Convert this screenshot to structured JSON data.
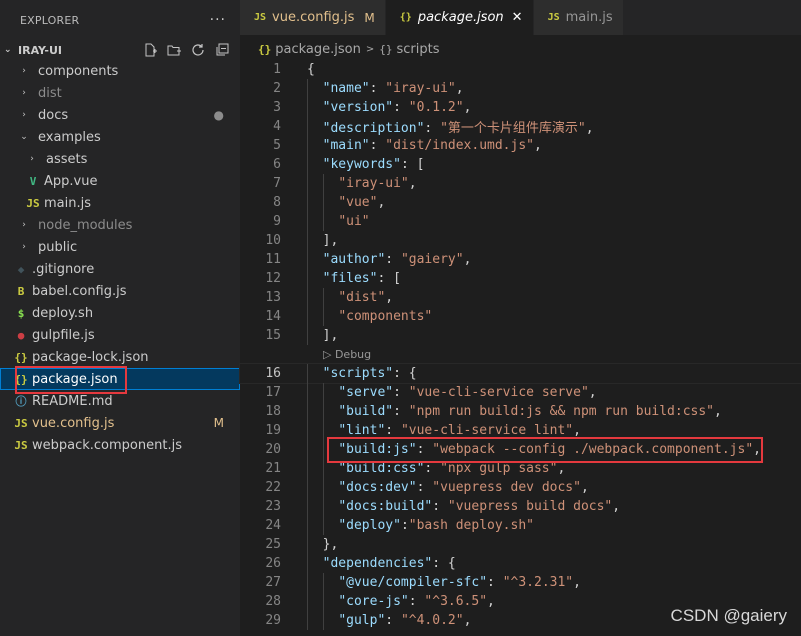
{
  "explorer": {
    "title": "EXPLORER",
    "more": "···",
    "project": "IRAY-UI",
    "items": [
      {
        "label": "components",
        "chev": "›",
        "icon": "",
        "icon_color": "",
        "color": "#cccccc",
        "indent": 18,
        "badge": ""
      },
      {
        "label": "dist",
        "chev": "›",
        "icon": "",
        "icon_color": "",
        "color": "#8c8c8c",
        "indent": 18,
        "badge": ""
      },
      {
        "label": "docs",
        "chev": "›",
        "icon": "",
        "icon_color": "",
        "color": "#cccccc",
        "indent": 18,
        "badge": "●"
      },
      {
        "label": "examples",
        "chev": "⌄",
        "icon": "",
        "icon_color": "",
        "color": "#cccccc",
        "indent": 18,
        "badge": ""
      },
      {
        "label": "assets",
        "chev": "›",
        "icon": "",
        "icon_color": "",
        "color": "#cccccc",
        "indent": 26,
        "badge": ""
      },
      {
        "label": "App.vue",
        "chev": "",
        "icon": "V",
        "icon_color": "#41b883",
        "color": "#cccccc",
        "indent": 26,
        "badge": ""
      },
      {
        "label": "main.js",
        "chev": "",
        "icon": "JS",
        "icon_color": "#cbcb41",
        "color": "#cccccc",
        "indent": 26,
        "badge": ""
      },
      {
        "label": "node_modules",
        "chev": "›",
        "icon": "",
        "icon_color": "",
        "color": "#8c8c8c",
        "indent": 18,
        "badge": ""
      },
      {
        "label": "public",
        "chev": "›",
        "icon": "",
        "icon_color": "",
        "color": "#cccccc",
        "indent": 18,
        "badge": ""
      },
      {
        "label": ".gitignore",
        "chev": "",
        "icon": "◆",
        "icon_color": "#41535b",
        "color": "#cccccc",
        "indent": 14,
        "badge": ""
      },
      {
        "label": "babel.config.js",
        "chev": "",
        "icon": "B",
        "icon_color": "#cbcb41",
        "color": "#cccccc",
        "indent": 14,
        "badge": ""
      },
      {
        "label": "deploy.sh",
        "chev": "",
        "icon": "$",
        "icon_color": "#89e051",
        "color": "#cccccc",
        "indent": 14,
        "badge": ""
      },
      {
        "label": "gulpfile.js",
        "chev": "",
        "icon": "●",
        "icon_color": "#cc3e44",
        "color": "#cccccc",
        "indent": 14,
        "badge": ""
      },
      {
        "label": "package-lock.json",
        "chev": "",
        "icon": "{}",
        "icon_color": "#cbcb41",
        "color": "#cccccc",
        "indent": 14,
        "badge": ""
      },
      {
        "label": "package.json",
        "chev": "",
        "icon": "{}",
        "icon_color": "#cbcb41",
        "color": "#ffffff",
        "indent": 14,
        "badge": "",
        "selected": true
      },
      {
        "label": "README.md",
        "chev": "",
        "icon": "ⓘ",
        "icon_color": "#519aba",
        "color": "#cccccc",
        "indent": 14,
        "badge": ""
      },
      {
        "label": "vue.config.js",
        "chev": "",
        "icon": "JS",
        "icon_color": "#cbcb41",
        "color": "#e2c08d",
        "indent": 14,
        "badge": "M"
      },
      {
        "label": "webpack.component.js",
        "chev": "",
        "icon": "JS",
        "icon_color": "#cbcb41",
        "color": "#cccccc",
        "indent": 14,
        "badge": ""
      }
    ]
  },
  "tabs": [
    {
      "icon": "JS",
      "label": "vue.config.js",
      "mod": "M",
      "close": "",
      "active": false
    },
    {
      "icon": "{}",
      "label": "package.json",
      "mod": "",
      "close": "✕",
      "active": true
    },
    {
      "icon": "JS",
      "label": "main.js",
      "mod": "",
      "close": "",
      "active": false
    }
  ],
  "breadcrumb": {
    "icon": "{}",
    "file": "package.json",
    "sep": ">",
    "icon2": "{}",
    "node": "scripts"
  },
  "codelens": "▷ Debug",
  "code": [
    {
      "n": "1",
      "indent": 0,
      "t": [
        [
          "p",
          "{"
        ]
      ]
    },
    {
      "n": "2",
      "indent": 1,
      "t": [
        [
          "k",
          "\"name\""
        ],
        [
          "p",
          ": "
        ],
        [
          "s",
          "\"iray-ui\""
        ],
        [
          "p",
          ","
        ]
      ]
    },
    {
      "n": "3",
      "indent": 1,
      "t": [
        [
          "k",
          "\"version\""
        ],
        [
          "p",
          ": "
        ],
        [
          "s",
          "\"0.1.2\""
        ],
        [
          "p",
          ","
        ]
      ]
    },
    {
      "n": "4",
      "indent": 1,
      "t": [
        [
          "k",
          "\"description\""
        ],
        [
          "p",
          ": "
        ],
        [
          "s",
          "\"第一个卡片组件库演示\""
        ],
        [
          "p",
          ","
        ]
      ]
    },
    {
      "n": "5",
      "indent": 1,
      "t": [
        [
          "k",
          "\"main\""
        ],
        [
          "p",
          ": "
        ],
        [
          "s",
          "\"dist/index.umd.js\""
        ],
        [
          "p",
          ","
        ]
      ]
    },
    {
      "n": "6",
      "indent": 1,
      "t": [
        [
          "k",
          "\"keywords\""
        ],
        [
          "p",
          ": ["
        ]
      ]
    },
    {
      "n": "7",
      "indent": 2,
      "t": [
        [
          "s",
          "\"iray-ui\""
        ],
        [
          "p",
          ","
        ]
      ]
    },
    {
      "n": "8",
      "indent": 2,
      "t": [
        [
          "s",
          "\"vue\""
        ],
        [
          "p",
          ","
        ]
      ]
    },
    {
      "n": "9",
      "indent": 2,
      "t": [
        [
          "s",
          "\"ui\""
        ]
      ]
    },
    {
      "n": "10",
      "indent": 1,
      "t": [
        [
          "p",
          "],"
        ]
      ]
    },
    {
      "n": "11",
      "indent": 1,
      "t": [
        [
          "k",
          "\"author\""
        ],
        [
          "p",
          ": "
        ],
        [
          "s",
          "\"gaiery\""
        ],
        [
          "p",
          ","
        ]
      ]
    },
    {
      "n": "12",
      "indent": 1,
      "t": [
        [
          "k",
          "\"files\""
        ],
        [
          "p",
          ": ["
        ]
      ]
    },
    {
      "n": "13",
      "indent": 2,
      "t": [
        [
          "s",
          "\"dist\""
        ],
        [
          "p",
          ","
        ]
      ]
    },
    {
      "n": "14",
      "indent": 2,
      "t": [
        [
          "s",
          "\"components\""
        ]
      ]
    },
    {
      "n": "15",
      "indent": 1,
      "t": [
        [
          "p",
          "],"
        ]
      ]
    },
    {
      "lens": true
    },
    {
      "n": "16",
      "indent": 1,
      "cur": true,
      "t": [
        [
          "k",
          "\"scripts\""
        ],
        [
          "p",
          ": {"
        ]
      ]
    },
    {
      "n": "17",
      "indent": 2,
      "t": [
        [
          "k",
          "\"serve\""
        ],
        [
          "p",
          ": "
        ],
        [
          "s",
          "\"vue-cli-service serve\""
        ],
        [
          "p",
          ","
        ]
      ]
    },
    {
      "n": "18",
      "indent": 2,
      "t": [
        [
          "k",
          "\"build\""
        ],
        [
          "p",
          ": "
        ],
        [
          "s",
          "\"npm run build:js && npm run build:css\""
        ],
        [
          "p",
          ","
        ]
      ]
    },
    {
      "n": "19",
      "indent": 2,
      "t": [
        [
          "k",
          "\"lint\""
        ],
        [
          "p",
          ": "
        ],
        [
          "s",
          "\"vue-cli-service lint\""
        ],
        [
          "p",
          ","
        ]
      ]
    },
    {
      "n": "20",
      "indent": 2,
      "t": [
        [
          "k",
          "\"build:js\""
        ],
        [
          "p",
          ": "
        ],
        [
          "s",
          "\"webpack --config ./webpack.component.js\""
        ],
        [
          "p",
          ","
        ]
      ]
    },
    {
      "n": "21",
      "indent": 2,
      "t": [
        [
          "k",
          "\"build:css\""
        ],
        [
          "p",
          ": "
        ],
        [
          "s",
          "\"npx gulp sass\""
        ],
        [
          "p",
          ","
        ]
      ]
    },
    {
      "n": "22",
      "indent": 2,
      "t": [
        [
          "k",
          "\"docs:dev\""
        ],
        [
          "p",
          ": "
        ],
        [
          "s",
          "\"vuepress dev docs\""
        ],
        [
          "p",
          ","
        ]
      ]
    },
    {
      "n": "23",
      "indent": 2,
      "t": [
        [
          "k",
          "\"docs:build\""
        ],
        [
          "p",
          ": "
        ],
        [
          "s",
          "\"vuepress build docs\""
        ],
        [
          "p",
          ","
        ]
      ]
    },
    {
      "n": "24",
      "indent": 2,
      "t": [
        [
          "k",
          "\"deploy\""
        ],
        [
          "p",
          ":"
        ],
        [
          "s",
          "\"bash deploy.sh\""
        ]
      ]
    },
    {
      "n": "25",
      "indent": 1,
      "t": [
        [
          "p",
          "},"
        ]
      ]
    },
    {
      "n": "26",
      "indent": 1,
      "t": [
        [
          "k",
          "\"dependencies\""
        ],
        [
          "p",
          ": {"
        ]
      ]
    },
    {
      "n": "27",
      "indent": 2,
      "t": [
        [
          "k",
          "\"@vue/compiler-sfc\""
        ],
        [
          "p",
          ": "
        ],
        [
          "s",
          "\"^3.2.31\""
        ],
        [
          "p",
          ","
        ]
      ]
    },
    {
      "n": "28",
      "indent": 2,
      "t": [
        [
          "k",
          "\"core-js\""
        ],
        [
          "p",
          ": "
        ],
        [
          "s",
          "\"^3.6.5\""
        ],
        [
          "p",
          ","
        ]
      ]
    },
    {
      "n": "29",
      "indent": 2,
      "t": [
        [
          "k",
          "\"gulp\""
        ],
        [
          "p",
          ": "
        ],
        [
          "s",
          "\"^4.0.2\""
        ],
        [
          "p",
          ","
        ]
      ]
    }
  ],
  "watermark": "CSDN @gaiery"
}
